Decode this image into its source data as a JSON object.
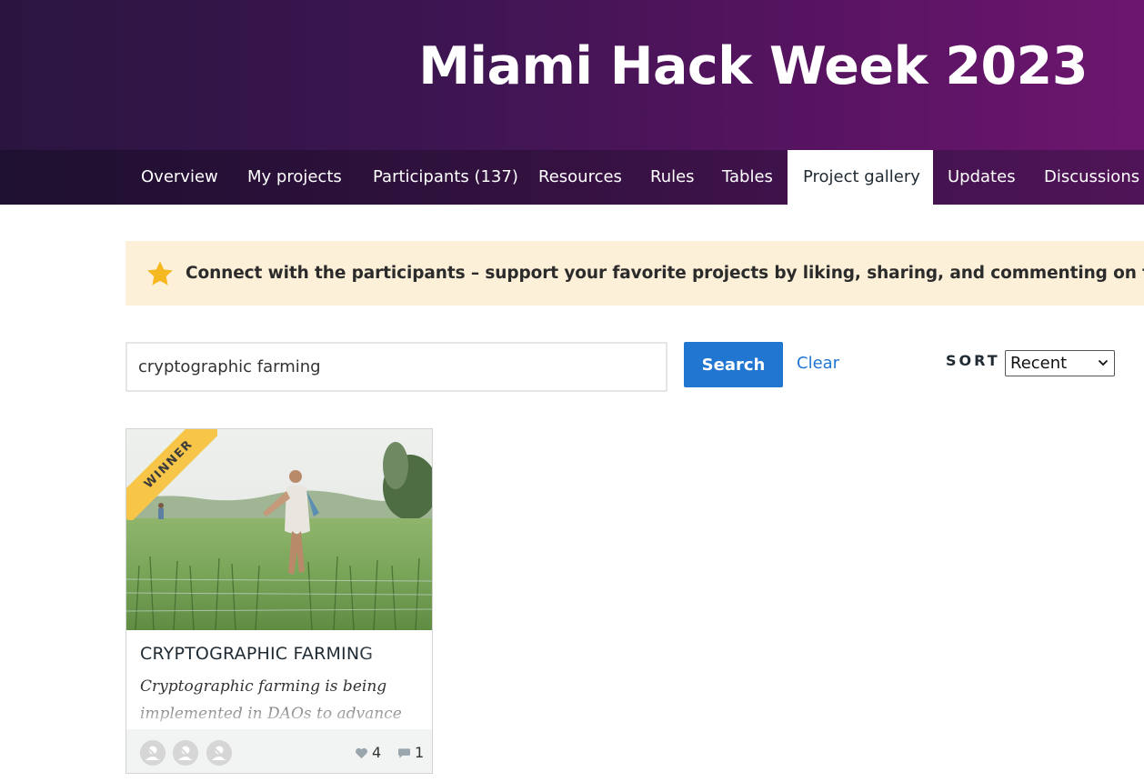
{
  "header": {
    "title": "Miami Hack Week 2023"
  },
  "nav": {
    "items": [
      {
        "label": "Overview"
      },
      {
        "label": "My projects"
      },
      {
        "label": "Participants (137)"
      },
      {
        "label": "Resources"
      },
      {
        "label": "Rules"
      },
      {
        "label": "Tables"
      },
      {
        "label": "Project gallery",
        "active": true
      },
      {
        "label": "Updates"
      },
      {
        "label": "Discussions"
      }
    ]
  },
  "banner": {
    "icon": "star-icon",
    "text": "Connect with the participants – support your favorite projects by liking, sharing, and commenting on them."
  },
  "search": {
    "value": "cryptographic farming",
    "button_label": "Search",
    "clear_label": "Clear"
  },
  "sort": {
    "label": "SORT",
    "selected": "Recent"
  },
  "projects": [
    {
      "badge": "WINNER",
      "title": "CRYPTOGRAPHIC FARMING",
      "description": "Cryptographic farming is being implemented in DAOs to advance",
      "likes": "4",
      "comments": "1",
      "member_icons": [
        "user-avatar-icon",
        "user-avatar-icon",
        "user-avatar-icon"
      ]
    }
  ],
  "colors": {
    "accent": "#2176d2",
    "banner_bg": "#fdf0d8",
    "star": "#f5b820",
    "ribbon": "#f7c547"
  }
}
